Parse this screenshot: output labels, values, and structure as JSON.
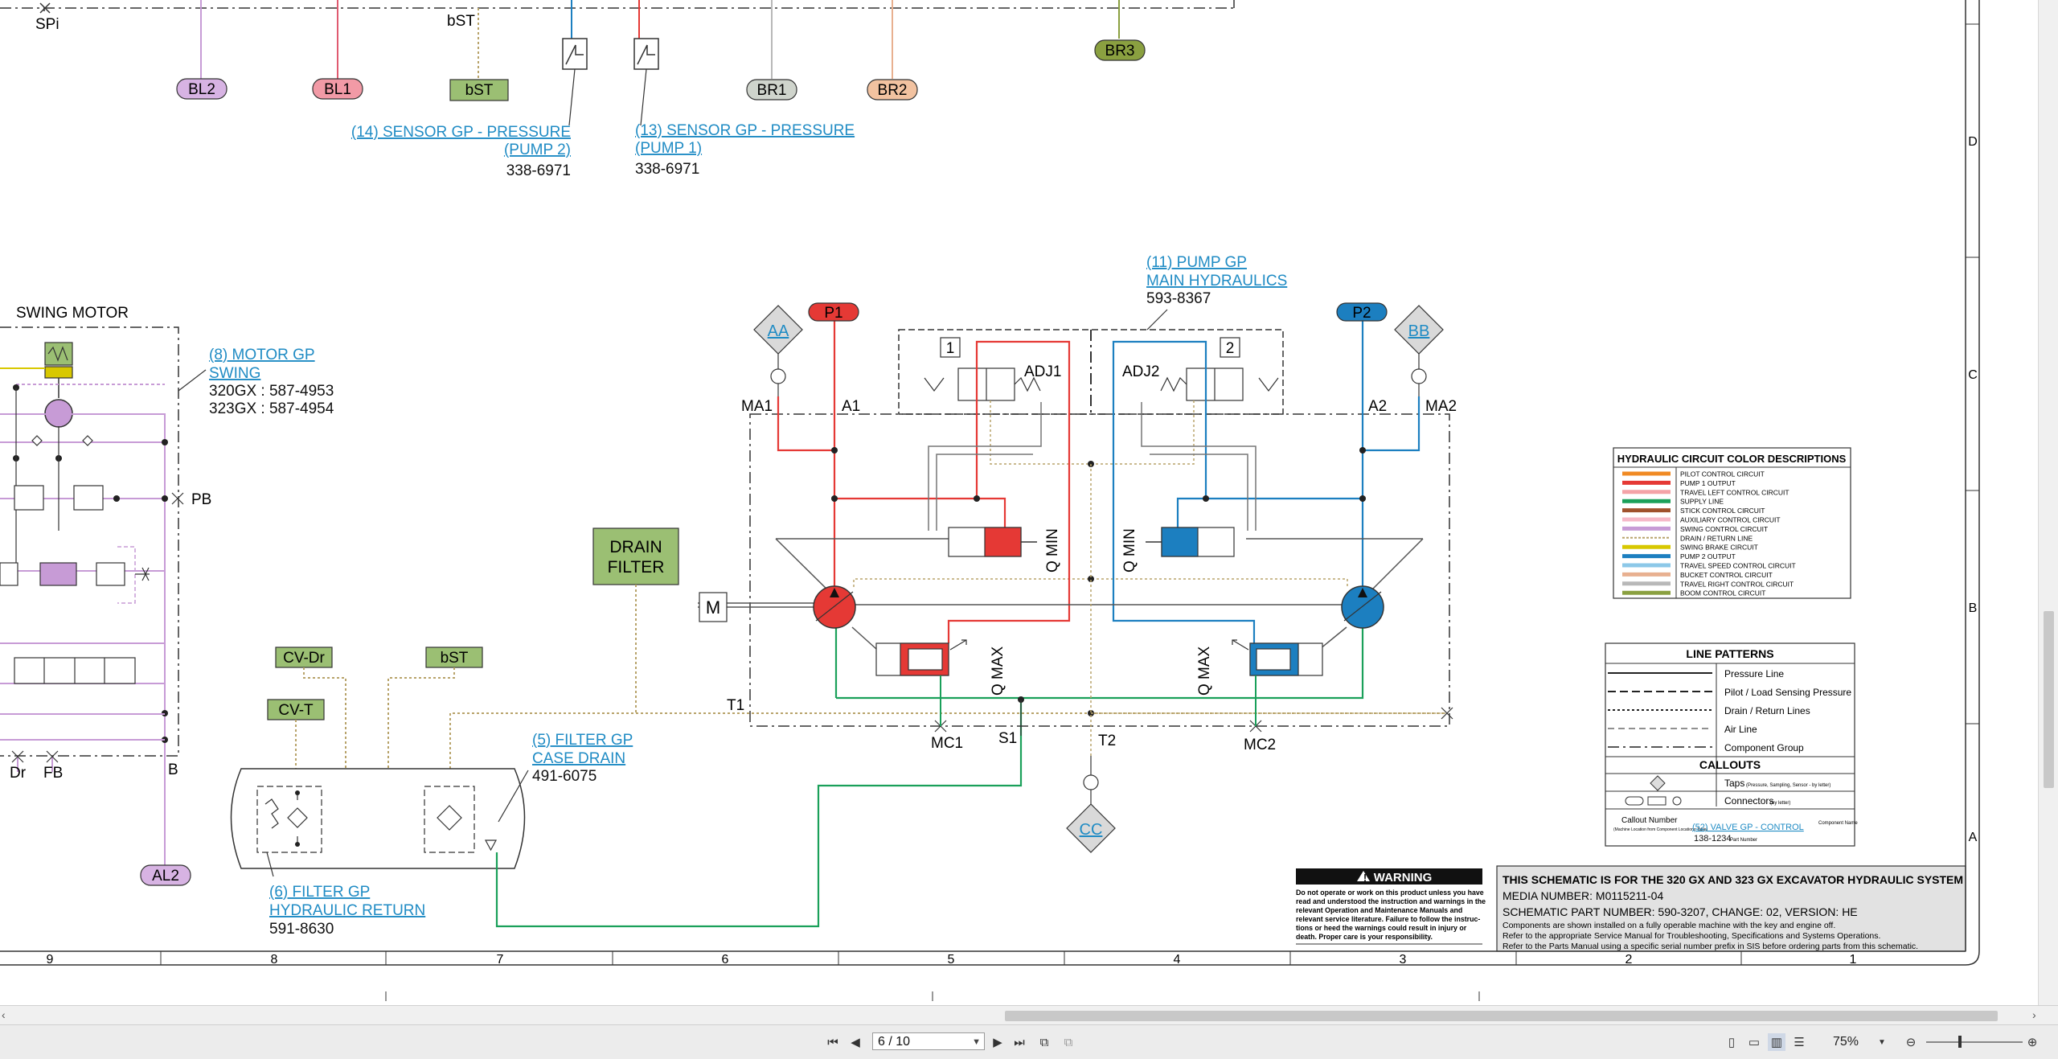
{
  "schematic": {
    "top_labels": {
      "spi": "SPi",
      "bst_top": "bST"
    },
    "connectors": {
      "bl2": "BL2",
      "bl1": "BL1",
      "bst1": "bST",
      "br1": "BR1",
      "br2": "BR2",
      "br3": "BR3",
      "al2": "AL2",
      "cv_dr": "CV-Dr",
      "bst2": "bST",
      "cv_t": "CV-T"
    },
    "callouts": {
      "sensor2": {
        "line1": "(14) SENSOR GP - PRESSURE",
        "line2": "(PUMP 2)",
        "part": "338-6971"
      },
      "sensor1": {
        "line1": "(13) SENSOR GP - PRESSURE",
        "line2": "(PUMP 1)",
        "part": "338-6971"
      },
      "pump": {
        "line1": "(11) PUMP GP",
        "line2": "MAIN HYDRAULICS",
        "part": "593-8367"
      },
      "motor": {
        "line1": "(8) MOTOR GP",
        "line2": "SWING",
        "part1": "320GX : 587-4953",
        "part2": "323GX : 587-4954"
      },
      "filter_case": {
        "line1": "(5) FILTER GP",
        "line2": "CASE DRAIN",
        "part": "491-6075"
      },
      "filter_return": {
        "line1": "(6) FILTER GP",
        "line2": "HYDRAULIC RETURN",
        "part": "591-8630"
      }
    },
    "labels": {
      "swing_motor": "SWING MOTOR",
      "drain_filter_1": "DRAIN",
      "drain_filter_2": "FILTER",
      "p1": "P1",
      "p2": "P2",
      "aa": "AA",
      "bb": "BB",
      "cc": "CC",
      "ma1": "MA1",
      "a1": "A1",
      "a2": "A2",
      "ma2": "MA2",
      "adj1": "ADJ1",
      "adj2": "ADJ2",
      "n1": "1",
      "n2": "2",
      "qmin_l": "Q MIN",
      "qmin_r": "Q MIN",
      "qmax_l": "Q MAX",
      "qmax_r": "Q MAX",
      "t1": "T1",
      "t2": "T2",
      "s1": "S1",
      "mc1": "MC1",
      "mc2": "MC2",
      "pb": "PB",
      "dr": "Dr",
      "fb": "FB",
      "b": "B",
      "m": "M"
    },
    "grid_cols": [
      "9",
      "8",
      "7",
      "6",
      "5",
      "4",
      "3",
      "2",
      "1"
    ],
    "grid_rows": [
      "D",
      "C",
      "B",
      "A"
    ],
    "color_legend": {
      "title": "HYDRAULIC CIRCUIT COLOR DESCRIPTIONS",
      "items": [
        {
          "label": "PILOT CONTROL CIRCUIT",
          "color": "#f08a24"
        },
        {
          "label": "PUMP 1 OUTPUT",
          "color": "#e53935"
        },
        {
          "label": "TRAVEL LEFT CONTROL CIRCUIT",
          "color": "#f4a3a8"
        },
        {
          "label": "SUPPLY LINE",
          "color": "#1aa05a"
        },
        {
          "label": "STICK CONTROL CIRCUIT",
          "color": "#a0522d"
        },
        {
          "label": "AUXILIARY CONTROL CIRCUIT",
          "color": "#f6b8c8"
        },
        {
          "label": "SWING CONTROL CIRCUIT",
          "color": "#c79bd6"
        },
        {
          "label": "DRAIN / RETURN LINE",
          "color": "#b8a36a"
        },
        {
          "label": "SWING BRAKE CIRCUIT",
          "color": "#d8c800"
        },
        {
          "label": "PUMP 2 OUTPUT",
          "color": "#1c7fc0"
        },
        {
          "label": "TRAVEL SPEED CONTROL CIRCUIT",
          "color": "#8cc8e8"
        },
        {
          "label": "BUCKET CONTROL CIRCUIT",
          "color": "#e8b090"
        },
        {
          "label": "TRAVEL RIGHT CONTROL CIRCUIT",
          "color": "#b8b8b8"
        },
        {
          "label": "BOOM CONTROL CIRCUIT",
          "color": "#8aa040"
        }
      ]
    },
    "line_patterns": {
      "title": "LINE PATTERNS",
      "items": [
        "Pressure Line",
        "Pilot / Load Sensing Pressure",
        "Drain / Return Lines",
        "Air Line",
        "Component Group"
      ],
      "callouts_title": "CALLOUTS",
      "taps": "Taps",
      "taps_note": "(Pressure, Sampling, Sensor - by letter)",
      "connectors": "Connectors",
      "connectors_note": "(by letter)",
      "callout_number": "Callout Number",
      "callout_note": "(Machine Location from Component Locations Table)",
      "example_callout": "(52) VALVE GP - CONTROL",
      "example_part": "138-1234",
      "component_name": "Component Name",
      "part_number": "Part Number"
    },
    "warning": {
      "title": "WARNING",
      "text": [
        "Do not operate or work on this product unless you have",
        "read and understood the instruction and warnings in the",
        "relevant Operation and Maintenance Manuals and",
        "relevant service literature. Failure to follow the instruc-",
        "tions or heed the warnings could result in injury or",
        "death. Proper care is your responsibility."
      ]
    },
    "title_block": {
      "line1": "THIS SCHEMATIC IS FOR THE 320 GX AND 323 GX EXCAVATOR HYDRAULIC SYSTEM",
      "line2": "MEDIA NUMBER: M0115211-04",
      "line3": "SCHEMATIC PART NUMBER: 590-3207, CHANGE: 02, VERSION: HE",
      "line4": "Components are shown installed on a fully operable machine with the key and engine off.",
      "line5": "Refer to the appropriate Service Manual for Troubleshooting, Specifications and Systems Operations.",
      "line6": "Refer to the Parts Manual using a specific serial number prefix in SIS before ordering parts from this schematic."
    }
  },
  "toolbar": {
    "page_value": "6 / 10",
    "zoom": "75%"
  }
}
